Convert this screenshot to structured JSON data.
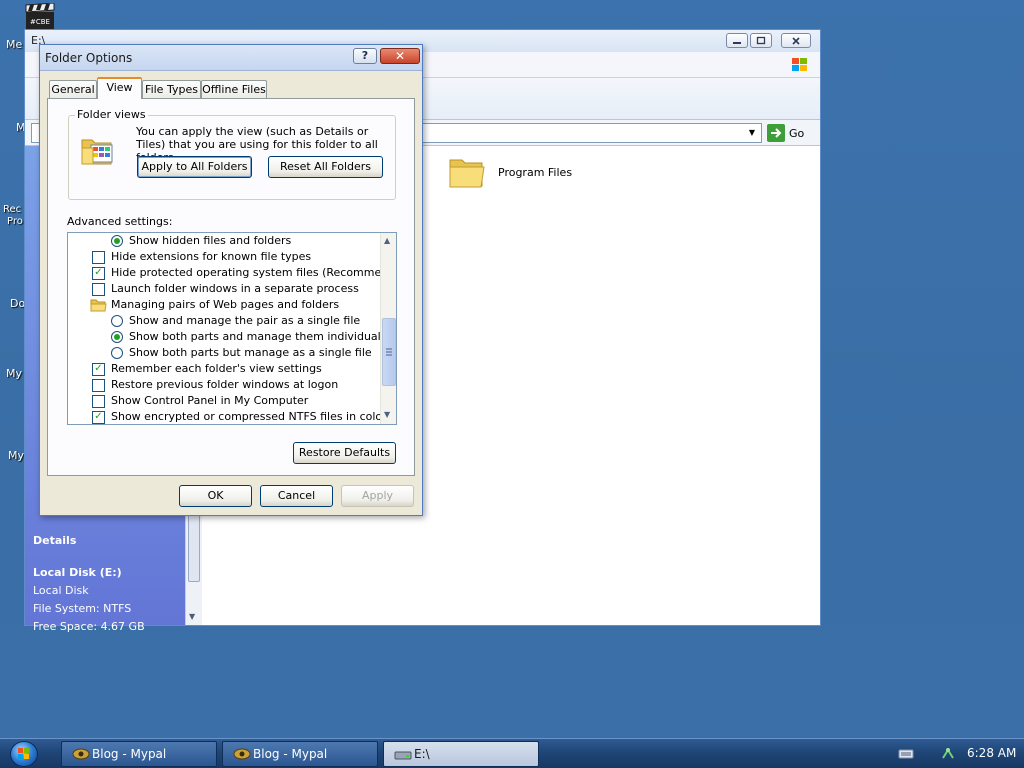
{
  "desktop": {
    "icon_labels": [
      "Me",
      "M",
      "Rec",
      "Pro",
      "Do",
      "My",
      "My"
    ],
    "movie_icon_text": "#CBE"
  },
  "explorer": {
    "title": "E:\\",
    "address_value": "",
    "go_label": "Go",
    "details": {
      "title": "Details",
      "name": "Local Disk (E:)",
      "type": "Local Disk",
      "filesystem": "File System: NTFS",
      "free_space": "Free Space: 4.67 GB"
    },
    "items": [
      {
        "label": "Program Files",
        "icon": "folder-icon"
      }
    ]
  },
  "dialog": {
    "title": "Folder Options",
    "help_label": "?",
    "close_label": "✕",
    "tabs": [
      {
        "label": "General",
        "active": false
      },
      {
        "label": "View",
        "active": true
      },
      {
        "label": "File Types",
        "active": false
      },
      {
        "label": "Offline Files",
        "active": false
      }
    ],
    "folder_views": {
      "legend": "Folder views",
      "description": "You can apply the view (such as Details or Tiles) that you are using for this folder to all folders.",
      "apply_label": "Apply to All Folders",
      "reset_label": "Reset All Folders"
    },
    "advanced_label": "Advanced settings:",
    "advanced_items": [
      {
        "type": "radio",
        "checked": true,
        "indent": 1,
        "label": "Show hidden files and folders"
      },
      {
        "type": "checkbox",
        "checked": false,
        "indent": 0,
        "label": "Hide extensions for known file types"
      },
      {
        "type": "checkbox",
        "checked": true,
        "indent": 0,
        "label": "Hide protected operating system files (Recommended)"
      },
      {
        "type": "checkbox",
        "checked": false,
        "indent": 0,
        "label": "Launch folder windows in a separate process"
      },
      {
        "type": "folder",
        "checked": false,
        "indent": 0,
        "label": "Managing pairs of Web pages and folders"
      },
      {
        "type": "radio",
        "checked": false,
        "indent": 1,
        "label": "Show and manage the pair as a single file"
      },
      {
        "type": "radio",
        "checked": true,
        "indent": 1,
        "label": "Show both parts and manage them individually"
      },
      {
        "type": "radio",
        "checked": false,
        "indent": 1,
        "label": "Show both parts but manage as a single file"
      },
      {
        "type": "checkbox",
        "checked": true,
        "indent": 0,
        "label": "Remember each folder's view settings"
      },
      {
        "type": "checkbox",
        "checked": false,
        "indent": 0,
        "label": "Restore previous folder windows at logon"
      },
      {
        "type": "checkbox",
        "checked": false,
        "indent": 0,
        "label": "Show Control Panel in My Computer"
      },
      {
        "type": "checkbox",
        "checked": true,
        "indent": 0,
        "label": "Show encrypted or compressed NTFS files in color"
      }
    ],
    "restore_defaults_label": "Restore Defaults",
    "ok_label": "OK",
    "cancel_label": "Cancel",
    "apply_label": "Apply"
  },
  "taskbar": {
    "buttons": [
      {
        "label": "Blog - Mypal",
        "active": false
      },
      {
        "label": "Blog - Mypal",
        "active": false
      },
      {
        "label": "E:\\",
        "active": true
      }
    ],
    "clock": "6:28 AM"
  }
}
